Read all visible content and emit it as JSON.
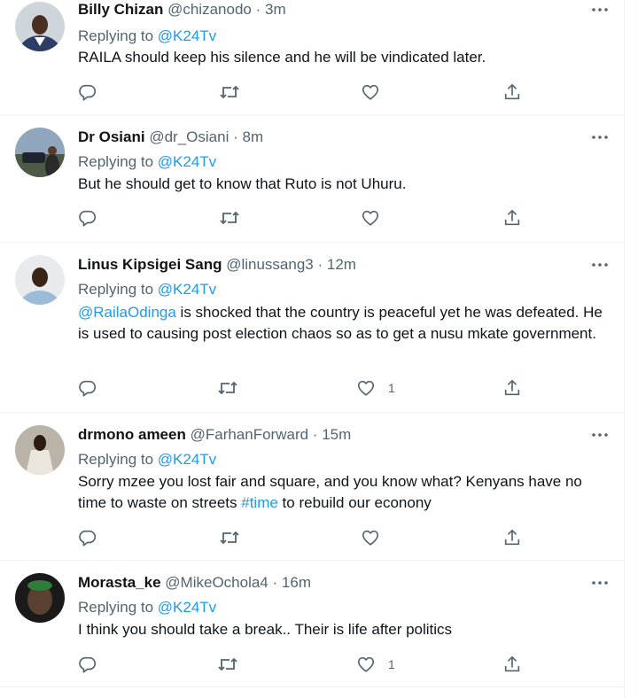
{
  "common": {
    "replying_prefix": "Replying to",
    "reply_target": "@K24Tv",
    "more_icon": "more-horizontal-icon",
    "reply_icon": "reply-icon",
    "retweet_icon": "retweet-icon",
    "like_icon": "heart-icon",
    "share_icon": "share-icon"
  },
  "colors": {
    "text": "#0f1419",
    "secondary": "#536471",
    "accent": "#1d9bf0",
    "divider": "#eff3f4"
  },
  "tweets": [
    {
      "name": "Billy Chizan",
      "handle": "@chizanodo",
      "time": "3m",
      "text_before": "",
      "mention": "",
      "text": "RAILA should keep his silence and he will be vindicated later.",
      "hashtag": "",
      "text_after": "",
      "likes": ""
    },
    {
      "name": "Dr Osiani",
      "handle": "@dr_Osiani",
      "time": "8m",
      "mention": "",
      "text": "But he should get to know that Ruto is not Uhuru.",
      "hashtag": "",
      "text_after": "",
      "likes": ""
    },
    {
      "name": "Linus Kipsigei Sang",
      "handle": "@linussang3",
      "time": "12m",
      "mention": "@RailaOdinga",
      "text": " is shocked that the country is peaceful yet he was defeated. He is used to causing post election chaos so as to get a nusu mkate government.",
      "hashtag": "",
      "text_after": "",
      "likes": "1"
    },
    {
      "name": "drmono ameen",
      "handle": "@FarhanForward",
      "time": "15m",
      "mention": "",
      "text": "Sorry mzee you lost fair and square, and you know what? Kenyans have no time to waste on streets ",
      "hashtag": "#time",
      "text_after": " to rebuild our econony",
      "likes": ""
    },
    {
      "name": "Morasta_ke",
      "handle": "@MikeOchola4",
      "time": "16m",
      "mention": "",
      "text": "I think you should take a break.. Their is life after politics",
      "hashtag": "",
      "text_after": "",
      "likes": "1"
    }
  ]
}
